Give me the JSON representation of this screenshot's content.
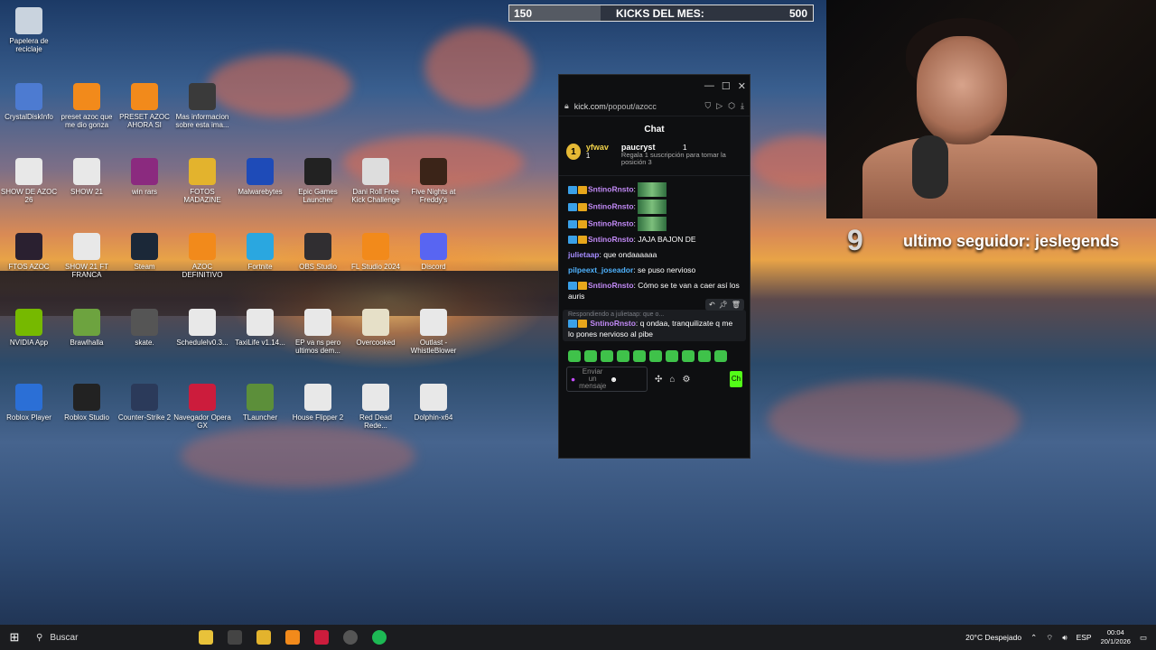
{
  "kicks_bar": {
    "current": "150",
    "label": "KICKS DEL MES:",
    "goal": "500",
    "progress_fraction": 0.3
  },
  "overlay": {
    "follower_count": "9",
    "follower_text": "ultimo seguidor: jeslegends"
  },
  "desktop_icons": [
    {
      "label": "Papelera de reciclaje",
      "icon": "recycle-bin-icon",
      "color": "#c9d3de"
    },
    {
      "label": "CrystalDiskInfo",
      "icon": "crystal-disk-icon",
      "color": "#4d7bd1"
    },
    {
      "label": "preset azoc que me dio gonza",
      "icon": "fl-studio-icon",
      "color": "#f28a1b"
    },
    {
      "label": "PRESET AZOC AHORA SI",
      "icon": "fl-studio-icon",
      "color": "#f28a1b"
    },
    {
      "label": "Mas informacion sobre esta ima...",
      "icon": "camera-icon",
      "color": "#3a3a3a"
    },
    {
      "label": "SHOW DE AZOC 26",
      "icon": "document-icon",
      "color": "#e8e8e8"
    },
    {
      "label": "SHOW 21",
      "icon": "document-icon",
      "color": "#e8e8e8"
    },
    {
      "label": "win rars",
      "icon": "winrar-icon",
      "color": "#8b2a7f"
    },
    {
      "label": "FOTOS MADAZINE",
      "icon": "folder-icon",
      "color": "#e3b32d"
    },
    {
      "label": "Malwarebytes",
      "icon": "malwarebytes-icon",
      "color": "#1e4bb8"
    },
    {
      "label": "Epic Games Launcher",
      "icon": "epic-games-icon",
      "color": "#222222"
    },
    {
      "label": "Dani Roll Free Kick Challenge",
      "icon": "soccer-ball-icon",
      "color": "#dddddd"
    },
    {
      "label": "Five Nights at Freddy's",
      "icon": "fnaf-icon",
      "color": "#3b2418"
    },
    {
      "label": "FTOS AZOC",
      "icon": "folder-icon",
      "color": "#2a2030"
    },
    {
      "label": "SHOW 21 FT FRANCA",
      "icon": "document-icon",
      "color": "#e8e8e8"
    },
    {
      "label": "Steam",
      "icon": "steam-icon",
      "color": "#1b2838"
    },
    {
      "label": "AZOC DEFINITIVO",
      "icon": "fl-studio-icon",
      "color": "#f28a1b"
    },
    {
      "label": "Fortnite",
      "icon": "fortnite-icon",
      "color": "#2aa7e0"
    },
    {
      "label": "OBS Studio",
      "icon": "obs-icon",
      "color": "#302e31"
    },
    {
      "label": "FL Studio 2024",
      "icon": "fl-studio-icon",
      "color": "#f28a1b"
    },
    {
      "label": "Discord",
      "icon": "discord-icon",
      "color": "#5865f2"
    },
    {
      "label": "NVIDIA App",
      "icon": "nvidia-icon",
      "color": "#76b900"
    },
    {
      "label": "Brawlhalla",
      "icon": "brawlhalla-icon",
      "color": "#6da33f"
    },
    {
      "label": "skate.",
      "icon": "skate-icon",
      "color": "#555555"
    },
    {
      "label": "ScheduleIv0.3...",
      "icon": "document-icon",
      "color": "#e8e8e8"
    },
    {
      "label": "TaxiLife v1.14...",
      "icon": "document-icon",
      "color": "#e8e8e8"
    },
    {
      "label": "EP va ns pero ultimos dem...",
      "icon": "document-icon",
      "color": "#e8e8e8"
    },
    {
      "label": "Overcooked",
      "icon": "overcooked-icon",
      "color": "#e6e0c8"
    },
    {
      "label": "Outlast - WhistleBlower",
      "icon": "document-icon",
      "color": "#e8e8e8"
    },
    {
      "label": "Roblox Player",
      "icon": "roblox-icon",
      "color": "#2b6fd6"
    },
    {
      "label": "Roblox Studio",
      "icon": "roblox-studio-icon",
      "color": "#222222"
    },
    {
      "label": "Counter-Strike 2",
      "icon": "cs2-icon",
      "color": "#2b3a5a"
    },
    {
      "label": "Navegador Opera GX",
      "icon": "opera-gx-icon",
      "color": "#cc1c3c"
    },
    {
      "label": "TLauncher",
      "icon": "minecraft-icon",
      "color": "#5c8f3a"
    },
    {
      "label": "House Flipper 2",
      "icon": "document-icon",
      "color": "#e8e8e8"
    },
    {
      "label": "Red Dead Rede...",
      "icon": "document-icon",
      "color": "#e8e8e8"
    },
    {
      "label": "Dolphin-x64",
      "icon": "archive-icon",
      "color": "#e8e8e8"
    }
  ],
  "chat": {
    "url_host": "kick.com",
    "url_path": "/popout/azocc",
    "title": "Chat",
    "pinned": {
      "rank": "1",
      "left_user": "yfwav",
      "left_count": "1",
      "right_user": "paucryst",
      "right_count": "1",
      "right_desc": "Regala 1 suscripción para tomar la posición 3"
    },
    "messages": [
      {
        "user": "SntinoRnsto",
        "color": "#c28af7",
        "text": "",
        "emote": true,
        "badges": true
      },
      {
        "user": "SntinoRnsto",
        "color": "#c28af7",
        "text": "",
        "emote": true,
        "badges": true
      },
      {
        "user": "SntinoRnsto",
        "color": "#c28af7",
        "text": "",
        "emote": true,
        "badges": true
      },
      {
        "user": "SntinoRnsto",
        "color": "#c28af7",
        "text": "JAJA BAJON DE",
        "emote": false,
        "badges": true
      },
      {
        "user": "julietaap",
        "color": "#a58cff",
        "text": "que ondaaaaaa",
        "emote": false,
        "badges": false
      },
      {
        "user": "pilpeext_joseador",
        "color": "#4fb3ff",
        "text": "se puso nervioso",
        "emote": false,
        "badges": false
      },
      {
        "user": "SntinoRnsto",
        "color": "#c28af7",
        "text": "Cómo se te van a caer así los auris",
        "emote": false,
        "badges": true
      }
    ],
    "reply_hint": "Respondiendo a julietaap: que o...",
    "hover_message": {
      "user": "SntinoRnsto",
      "color": "#c28af7",
      "text": "q ondaa, tranquilizate q me lo pones nervioso al pibe"
    },
    "input_placeholder": "Enviar un mensaje",
    "send_label": "Ch"
  },
  "taskbar": {
    "search_label": "Buscar",
    "weather": "20°C  Despejado",
    "language": "ESP",
    "time": "00:04",
    "date": "20/1/2026"
  }
}
